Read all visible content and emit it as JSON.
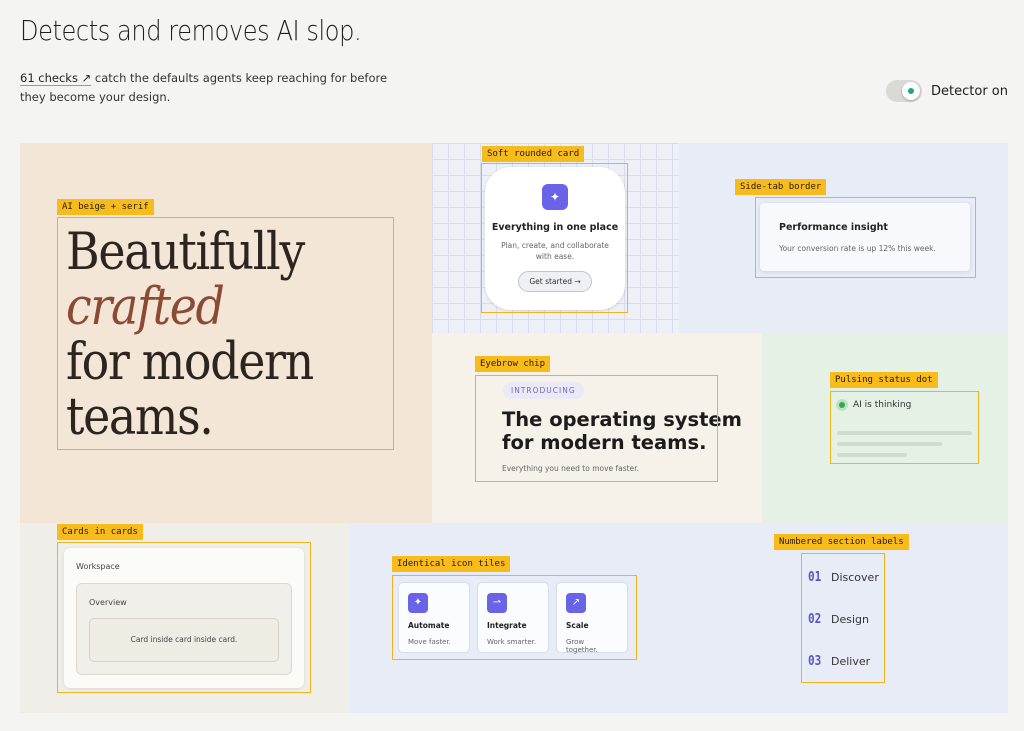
{
  "header": {
    "title": "Detects and removes AI slop.",
    "checks_link": "61 checks ↗",
    "intro_text": " catch the defaults agents keep reaching for before they become your design.",
    "toggle_label": "Detector on",
    "toggle_on": true
  },
  "colors": {
    "tag": "#f7bb1c",
    "accent": "#6a63e8",
    "status_green": "#34a853"
  },
  "panels": {
    "beige_serif": {
      "tag": "AI beige + serif",
      "line1": "Beautifully",
      "line2": "crafted",
      "line3": "for modern",
      "line4": "teams."
    },
    "soft_card": {
      "tag": "Soft rounded card",
      "icon": "sparkle-icon",
      "title": "Everything in one place",
      "desc": "Plan, create, and collaborate with ease.",
      "button": "Get started  →"
    },
    "side_tab": {
      "tag": "Side-tab border",
      "title": "Performance insight",
      "desc": "Your conversion rate is up 12% this week."
    },
    "eyebrow": {
      "tag": "Eyebrow chip",
      "chip": "INTRODUCING",
      "heading_line1": "The operating system",
      "heading_line2": "for modern teams.",
      "sub": "Everything you need to move faster."
    },
    "pulse": {
      "tag": "Pulsing status dot",
      "status": "AI is thinking"
    },
    "cards_in_cards": {
      "tag": "Cards in cards",
      "outer": "Workspace",
      "middle": "Overview",
      "inner": "Card inside card inside card."
    },
    "icon_tiles": {
      "tag": "Identical icon tiles",
      "tiles": [
        {
          "icon": "sparkle-icon",
          "glyph": "✦",
          "title": "Automate",
          "desc": "Move faster."
        },
        {
          "icon": "integrate-icon",
          "glyph": "⇀",
          "title": "Integrate",
          "desc": "Work smarter."
        },
        {
          "icon": "arrow-up-right-icon",
          "glyph": "↗",
          "title": "Scale",
          "desc": "Grow together."
        }
      ]
    },
    "numbered": {
      "tag": "Numbered section labels",
      "items": [
        {
          "num": "01",
          "label": "Discover"
        },
        {
          "num": "02",
          "label": "Design"
        },
        {
          "num": "03",
          "label": "Deliver"
        }
      ]
    }
  }
}
